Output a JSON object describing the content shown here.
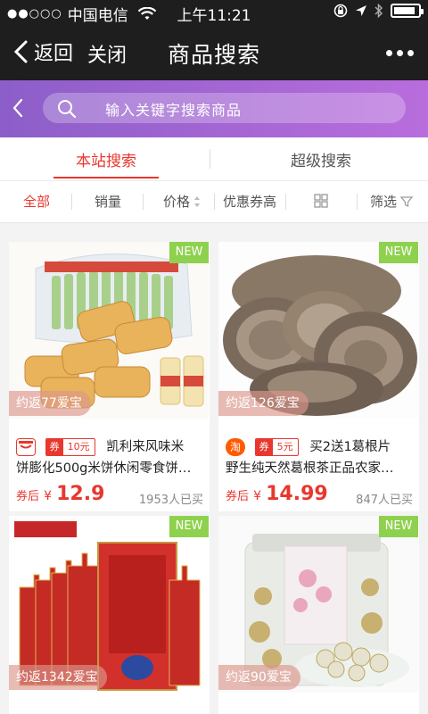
{
  "status_bar": {
    "carrier": "中国电信",
    "signal_dots": "●●○○○",
    "time": "上午11:21",
    "battery_level": 0.9
  },
  "nav": {
    "back_label": "返回",
    "close_label": "关闭",
    "title": "商品搜索"
  },
  "search": {
    "placeholder": "输入关键字搜索商品"
  },
  "tabs": [
    {
      "label": "本站搜索",
      "active": true
    },
    {
      "label": "超级搜索",
      "active": false
    }
  ],
  "filters": {
    "all": "全部",
    "sales": "销量",
    "price": "价格",
    "coupon_high": "优惠券高",
    "filter": "筛选"
  },
  "accent_color": "#e8372e",
  "products": [
    {
      "badge": "NEW",
      "rebate": "约返77爱宝",
      "platform_icon": "tmall-icon",
      "coupon_label": "券",
      "coupon_value": "10元",
      "title_1": "凯利来风味米",
      "title_2": "饼膨化500g米饼休闲零食饼…",
      "after_label": "券后",
      "currency": "¥",
      "price": "12.9",
      "sold": "1953人已买"
    },
    {
      "badge": "NEW",
      "rebate": "约返126爱宝",
      "platform_icon": "taobao-icon",
      "platform_text": "淘",
      "coupon_label": "券",
      "coupon_value": "5元",
      "title_1": "买2送1葛根片",
      "title_2": "野生纯天然葛根茶正品农家…",
      "after_label": "券后",
      "currency": "¥",
      "price": "14.99",
      "sold": "847人已买"
    },
    {
      "badge": "NEW",
      "rebate": "约返1342爱宝"
    },
    {
      "badge": "NEW",
      "rebate": "约返90爱宝"
    }
  ]
}
